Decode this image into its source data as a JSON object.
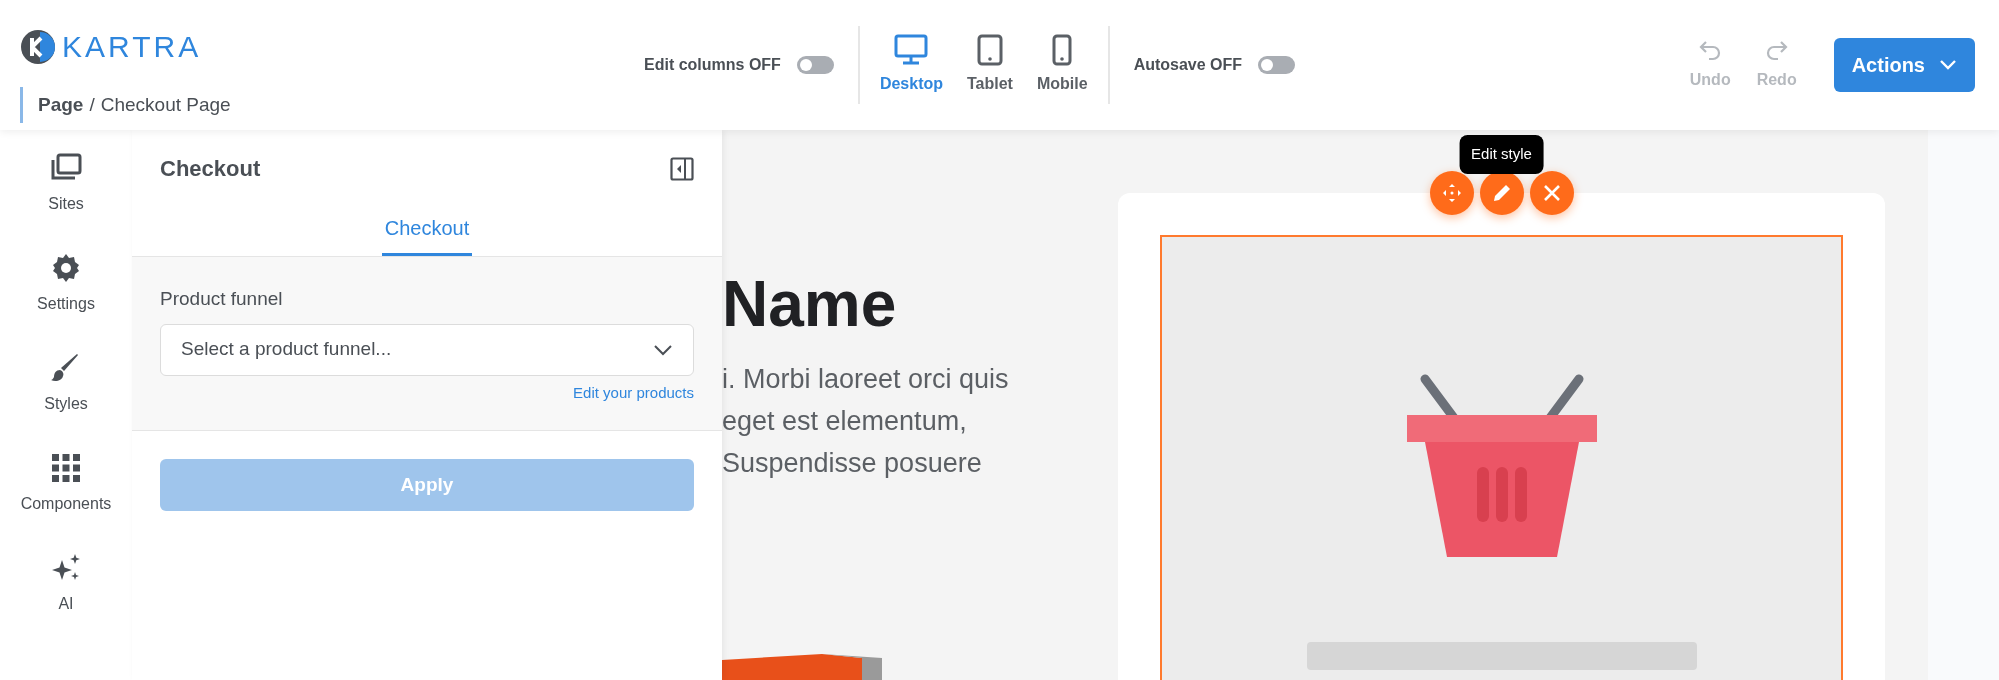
{
  "header": {
    "logo": "KARTRA",
    "breadcrumb": {
      "section": "Page",
      "separator": "/",
      "page": "Checkout Page"
    },
    "edit_columns": {
      "label": "Edit columns OFF",
      "on": false
    },
    "devices": [
      {
        "label": "Desktop",
        "selected": true
      },
      {
        "label": "Tablet",
        "selected": false
      },
      {
        "label": "Mobile",
        "selected": false
      }
    ],
    "autosave": {
      "label": "Autosave OFF",
      "on": false
    },
    "history": [
      {
        "label": "Undo",
        "disabled": true
      },
      {
        "label": "Redo",
        "disabled": true
      }
    ],
    "actions_button": "Actions"
  },
  "sidebar": {
    "items": [
      {
        "label": "Sites"
      },
      {
        "label": "Settings"
      },
      {
        "label": "Styles"
      },
      {
        "label": "Components"
      },
      {
        "label": "AI"
      }
    ]
  },
  "panel": {
    "title": "Checkout",
    "tabs": [
      {
        "label": "Checkout",
        "selected": true
      }
    ],
    "field_label": "Product funnel",
    "select_placeholder": "Select a product funnel...",
    "link": "Edit your products",
    "apply_button": {
      "label": "Apply",
      "disabled": true
    }
  },
  "canvas": {
    "heading": "Name",
    "text_lines": [
      "i. Morbi laoreet orci quis",
      "eget est elementum,",
      "Suspendisse posuere"
    ],
    "tooltip": "Edit style"
  }
}
